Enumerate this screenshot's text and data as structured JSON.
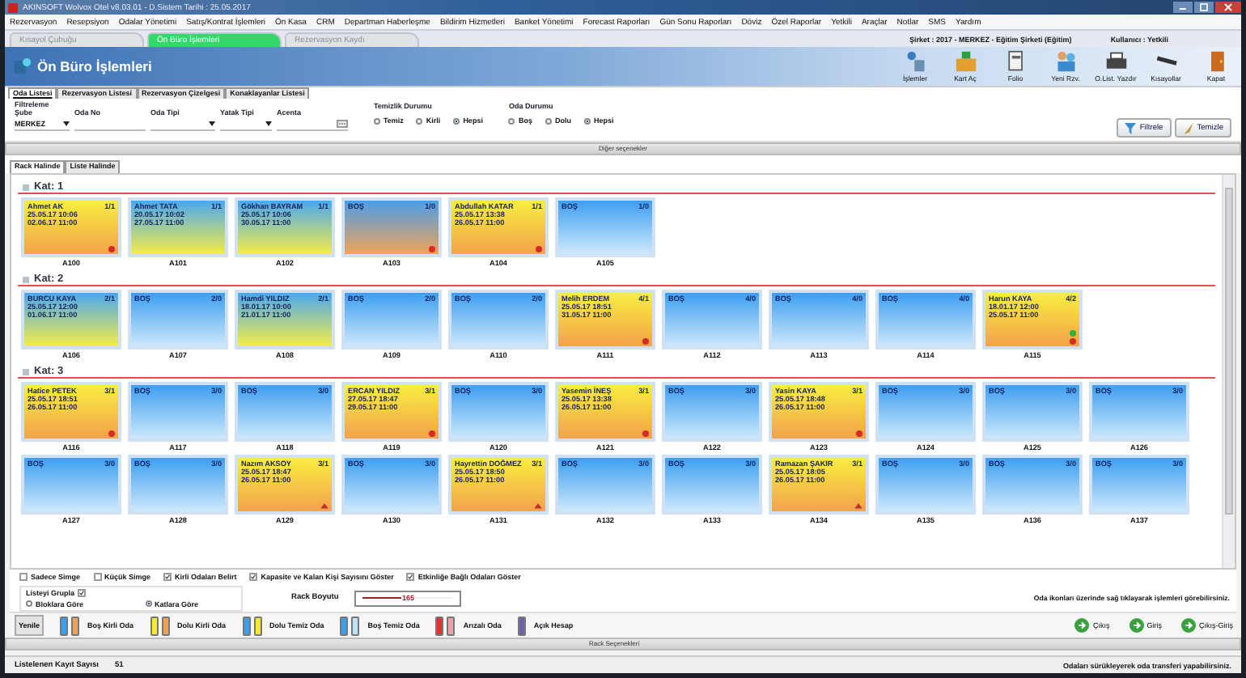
{
  "window": {
    "title": "AKINSOFT Wolvox Otel v8.03.01 - D.Sistem Tarihi : 25.05.2017"
  },
  "menu": [
    "Rezervasyon",
    "Resepsiyon",
    "Odalar Yönetimi",
    "Satış/Kontrat İşlemleri",
    "Ön Kasa",
    "CRM",
    "Departman Haberleşme",
    "Bildirim Hizmetleri",
    "Banket Yönetimi",
    "Forecast Raporları",
    "Gün Sonu Raporları",
    "Döviz",
    "Özel Raporlar",
    "Yetkili",
    "Araçlar",
    "Notlar",
    "SMS",
    "Yardım"
  ],
  "doc_tabs": [
    {
      "label": "Kısayol Çubuğu",
      "selected": false
    },
    {
      "label": "Ön Büro İşlemleri",
      "selected": true
    },
    {
      "label": "Rezervasyon Kaydı",
      "selected": false
    }
  ],
  "header": {
    "title": "Ön Büro İşlemleri",
    "company": "Şirket : 2017 - MERKEZ - Eğitim Şirketi (Eğitim)",
    "user": "Kullanıcı : Yetkili"
  },
  "toolbar": [
    {
      "label": "İşlemler",
      "kind": "operations"
    },
    {
      "label": "Kart Aç",
      "kind": "card"
    },
    {
      "label": "Folio",
      "kind": "folio"
    },
    {
      "label": "Yeni Rzv.",
      "kind": "people"
    },
    {
      "label": "O.List. Yazdır",
      "kind": "print"
    },
    {
      "label": "Kısayollar",
      "kind": "bar"
    },
    {
      "label": "Kapat",
      "kind": "door"
    }
  ],
  "sub_tabs": [
    {
      "label": "Oda Listesi",
      "selected": true
    },
    {
      "label": "Rezervasyon Listesi",
      "selected": false
    },
    {
      "label": "Rezervasyon Çizelgesi",
      "selected": false
    },
    {
      "label": "Konaklayanlar Listesi",
      "selected": false
    }
  ],
  "filters": {
    "title": "Filtreleme",
    "fields": [
      {
        "label": "Şube",
        "value": "MERKEZ",
        "kind": "dropdown"
      },
      {
        "label": "Oda No",
        "kind": "text"
      },
      {
        "label": "Oda Tipi",
        "kind": "dropdown"
      },
      {
        "label": "Yatak Tipi",
        "kind": "dropdown"
      },
      {
        "label": "Acenta",
        "kind": "lookup"
      }
    ],
    "groups": [
      {
        "label": "Temizlik Durumu",
        "options": [
          {
            "label": "Temiz",
            "selected": false
          },
          {
            "label": "Kirli",
            "selected": false
          },
          {
            "label": "Hepsi",
            "selected": true
          }
        ]
      },
      {
        "label": "Oda Durumu",
        "options": [
          {
            "label": "Boş",
            "selected": false
          },
          {
            "label": "Dolu",
            "selected": false
          },
          {
            "label": "Hepsi",
            "selected": true
          }
        ]
      }
    ],
    "buttons": [
      {
        "label": "Filtrele",
        "kind": "filter"
      },
      {
        "label": "Temizle",
        "kind": "clear"
      }
    ]
  },
  "other_options": "Diğer seçenekler",
  "view_tabs": [
    {
      "label": "Rack Halinde",
      "selected": true
    },
    {
      "label": "Liste Halinde",
      "selected": false
    }
  ],
  "floors": [
    {
      "title": "Kat: 1",
      "rows": [
        [
          {
            "number": "A100",
            "name": "Ahmet AK",
            "arrival": "25.05.17 10:06",
            "departure": "02.06.17 11:00",
            "occupancy": "1/1",
            "kind": "dolu_kirli",
            "alert": true,
            "ok": false,
            "note": false
          },
          {
            "number": "A101",
            "name": "Ahmet TATA",
            "arrival": "20.05.17 10:02",
            "departure": "27.05.17 11:00",
            "occupancy": "1/1",
            "kind": "dolu_temiz",
            "alert": false,
            "ok": false,
            "note": false
          },
          {
            "number": "A102",
            "name": "Gökhan BAYRAM",
            "arrival": "25.05.17 10:06",
            "departure": "30.05.17 11:00",
            "occupancy": "1/1",
            "kind": "dolu_temiz",
            "alert": false,
            "ok": false,
            "note": false
          },
          {
            "number": "A103",
            "name": "BOŞ",
            "occupancy": "1/0",
            "kind": "bos_kirli",
            "alert": true,
            "ok": false,
            "note": false
          },
          {
            "number": "A104",
            "name": "Abdullah KATAR",
            "arrival": "25.05.17 13:38",
            "departure": "26.05.17 11:00",
            "occupancy": "1/1",
            "kind": "dolu_kirli",
            "alert": true,
            "ok": false,
            "note": false
          },
          {
            "number": "A105",
            "name": "BOŞ",
            "occupancy": "1/0",
            "kind": "bos_temiz",
            "alert": false,
            "ok": false,
            "note": false
          }
        ]
      ]
    },
    {
      "title": "Kat: 2",
      "rows": [
        [
          {
            "number": "A106",
            "name": "BURCU KAYA",
            "arrival": "25.05.17 12:00",
            "departure": "01.06.17 11:00",
            "occupancy": "2/1",
            "kind": "dolu_temiz",
            "alert": false,
            "ok": false,
            "note": false
          },
          {
            "number": "A107",
            "name": "BOŞ",
            "occupancy": "2/0",
            "kind": "bos_temiz",
            "alert": false,
            "ok": false,
            "note": false
          },
          {
            "number": "A108",
            "name": "Hamdi YILDIZ",
            "arrival": "18.01.17 10:00",
            "departure": "21.01.17 11:00",
            "occupancy": "2/1",
            "kind": "dolu_temiz",
            "alert": false,
            "ok": false,
            "note": false
          },
          {
            "number": "A109",
            "name": "BOŞ",
            "occupancy": "2/0",
            "kind": "bos_temiz",
            "alert": false,
            "ok": false,
            "note": false
          },
          {
            "number": "A110",
            "name": "BOŞ",
            "occupancy": "2/0",
            "kind": "bos_temiz",
            "alert": false,
            "ok": false,
            "note": false
          },
          {
            "number": "A111",
            "name": "Melih ERDEM",
            "arrival": "25.05.17 18:51",
            "departure": "31.05.17 11:00",
            "occupancy": "4/1",
            "kind": "dolu_kirli",
            "alert": true,
            "ok": false,
            "note": false
          },
          {
            "number": "A112",
            "name": "BOŞ",
            "occupancy": "4/0",
            "kind": "bos_temiz",
            "alert": false,
            "ok": false,
            "note": false
          },
          {
            "number": "A113",
            "name": "BOŞ",
            "occupancy": "4/0",
            "kind": "bos_temiz",
            "alert": false,
            "ok": false,
            "note": false
          },
          {
            "number": "A114",
            "name": "BOŞ",
            "occupancy": "4/0",
            "kind": "bos_temiz",
            "alert": false,
            "ok": false,
            "note": false
          },
          {
            "number": "A115",
            "name": "Harun KAYA",
            "arrival": "18.01.17 12:00",
            "departure": "25.05.17 11:00",
            "occupancy": "4/2",
            "kind": "dolu_kirli",
            "alert": true,
            "ok": true,
            "note": false
          }
        ]
      ]
    },
    {
      "title": "Kat: 3",
      "rows": [
        [
          {
            "number": "A116",
            "name": "Hatice PETEK",
            "arrival": "25.05.17 18:51",
            "departure": "26.05.17 11:00",
            "occupancy": "3/1",
            "kind": "dolu_kirli",
            "alert": true,
            "ok": false,
            "note": false
          },
          {
            "number": "A117",
            "name": "BOŞ",
            "occupancy": "3/0",
            "kind": "bos_temiz",
            "alert": false,
            "ok": false,
            "note": false
          },
          {
            "number": "A118",
            "name": "BOŞ",
            "occupancy": "3/0",
            "kind": "bos_temiz",
            "alert": false,
            "ok": false,
            "note": false
          },
          {
            "number": "A119",
            "name": "ERCAN YILDIZ",
            "arrival": "27.05.17 18:47",
            "departure": "29.05.17 11:00",
            "occupancy": "3/1",
            "kind": "dolu_kirli",
            "alert": true,
            "ok": false,
            "note": false
          },
          {
            "number": "A120",
            "name": "BOŞ",
            "occupancy": "3/0",
            "kind": "bos_temiz",
            "alert": false,
            "ok": false,
            "note": false
          },
          {
            "number": "A121",
            "name": "Yasemin İNEŞ",
            "arrival": "25.05.17 13:38",
            "departure": "26.05.17 11:00",
            "occupancy": "3/1",
            "kind": "dolu_kirli",
            "alert": true,
            "ok": false,
            "note": false
          },
          {
            "number": "A122",
            "name": "BOŞ",
            "occupancy": "3/0",
            "kind": "bos_temiz",
            "alert": false,
            "ok": false,
            "note": false
          },
          {
            "number": "A123",
            "name": "Yasin KAYA",
            "arrival": "25.05.17 18:48",
            "departure": "26.05.17 11:00",
            "occupancy": "3/1",
            "kind": "dolu_kirli",
            "alert": true,
            "ok": false,
            "note": false
          },
          {
            "number": "A124",
            "name": "BOŞ",
            "occupancy": "3/0",
            "kind": "bos_temiz",
            "alert": false,
            "ok": false,
            "note": false
          },
          {
            "number": "A125",
            "name": "BOŞ",
            "occupancy": "3/0",
            "kind": "bos_temiz",
            "alert": false,
            "ok": false,
            "note": false
          },
          {
            "number": "A126",
            "name": "BOŞ",
            "occupancy": "3/0",
            "kind": "bos_temiz",
            "alert": false,
            "ok": false,
            "note": false
          }
        ],
        [
          {
            "number": "A127",
            "name": "BOŞ",
            "occupancy": "3/0",
            "kind": "bos_temiz",
            "alert": false,
            "ok": false,
            "note": false
          },
          {
            "number": "A128",
            "name": "BOŞ",
            "occupancy": "3/0",
            "kind": "bos_temiz",
            "alert": false,
            "ok": false,
            "note": false
          },
          {
            "number": "A129",
            "name": "Nazım AKSOY",
            "arrival": "25.05.17 18:47",
            "departure": "26.05.17 11:00",
            "occupancy": "3/1",
            "kind": "dolu_kirli",
            "alert": false,
            "ok": false,
            "note": true
          },
          {
            "number": "A130",
            "name": "BOŞ",
            "occupancy": "3/0",
            "kind": "bos_temiz",
            "alert": false,
            "ok": false,
            "note": false
          },
          {
            "number": "A131",
            "name": "Hayrettin DOĞMEZ",
            "arrival": "25.05.17 18:50",
            "departure": "26.05.17 11:00",
            "occupancy": "3/1",
            "kind": "dolu_kirli",
            "alert": false,
            "ok": false,
            "note": true
          },
          {
            "number": "A132",
            "name": "BOŞ",
            "occupancy": "3/0",
            "kind": "bos_temiz",
            "alert": false,
            "ok": false,
            "note": false
          },
          {
            "number": "A133",
            "name": "BOŞ",
            "occupancy": "3/0",
            "kind": "bos_temiz",
            "alert": false,
            "ok": false,
            "note": false
          },
          {
            "number": "A134",
            "name": "Ramazan ŞAKIR",
            "arrival": "25.05.17 18:05",
            "departure": "26.05.17 11:00",
            "occupancy": "3/1",
            "kind": "dolu_kirli",
            "alert": false,
            "ok": false,
            "note": true
          },
          {
            "number": "A135",
            "name": "BOŞ",
            "occupancy": "3/0",
            "kind": "bos_temiz",
            "alert": false,
            "ok": false,
            "note": false
          },
          {
            "number": "A136",
            "name": "BOŞ",
            "occupancy": "3/0",
            "kind": "bos_temiz",
            "alert": false,
            "ok": false,
            "note": false
          },
          {
            "number": "A137",
            "name": "BOŞ",
            "occupancy": "3/0",
            "kind": "bos_temiz",
            "alert": false,
            "ok": false,
            "note": false
          }
        ]
      ]
    }
  ],
  "display_options": [
    {
      "label": "Sadece Simge",
      "checked": false
    },
    {
      "label": "Küçük Simge",
      "checked": false
    },
    {
      "label": "Kirli Odaları Belirt",
      "checked": true
    },
    {
      "label": "Kapasite ve Kalan Kişi Sayısını Göster",
      "checked": true
    },
    {
      "label": "Etkinliğe Bağlı Odaları Göster",
      "checked": true
    }
  ],
  "grouping": {
    "label": "Listeyi Grupla",
    "checked": true,
    "options": [
      {
        "label": "Bloklara Göre",
        "selected": false
      },
      {
        "label": "Katlara Göre",
        "selected": true
      }
    ]
  },
  "rack_size": {
    "label": "Rack Boyutu",
    "value": "165",
    "level": 0.5
  },
  "hint": "Oda ikonları üzerinde sağ tıklayarak işlemleri görebilirsiniz.",
  "legend": {
    "button": "Yenile",
    "items": [
      {
        "label": "Boş Kirli Oda",
        "swatches": [
          {
            "color": "#3aa0f0"
          },
          {
            "color": "#f0a050"
          }
        ]
      },
      {
        "label": "Dolu Kirli Oda",
        "swatches": [
          {
            "color": "#f5e83a"
          },
          {
            "color": "#f0a050"
          }
        ]
      },
      {
        "label": "Dolu Temiz Oda",
        "swatches": [
          {
            "color": "#3aa0f0"
          },
          {
            "color": "#f5e83a"
          }
        ]
      },
      {
        "label": "Boş Temiz Oda",
        "swatches": [
          {
            "color": "#3aa0f0"
          },
          {
            "color": "#bfe3f8"
          }
        ]
      },
      {
        "label": "Arızalı Oda",
        "swatches": [
          {
            "color": "#e83030"
          },
          {
            "color": "#f0a0a8"
          }
        ]
      },
      {
        "label": "Açık Hesap",
        "swatches": [
          {
            "color": "#7060b0"
          }
        ]
      }
    ]
  },
  "actions": [
    {
      "label": "Çıkış"
    },
    {
      "label": "Giriş"
    },
    {
      "label": "Çıkış-Giriş"
    }
  ],
  "rack_options": "Rack Seçenekleri",
  "status_bar": {
    "label": "Listelenen Kayıt Sayısı",
    "count": "51",
    "hint": "Odaları sürükleyerek oda transferi yapabilirsiniz."
  }
}
